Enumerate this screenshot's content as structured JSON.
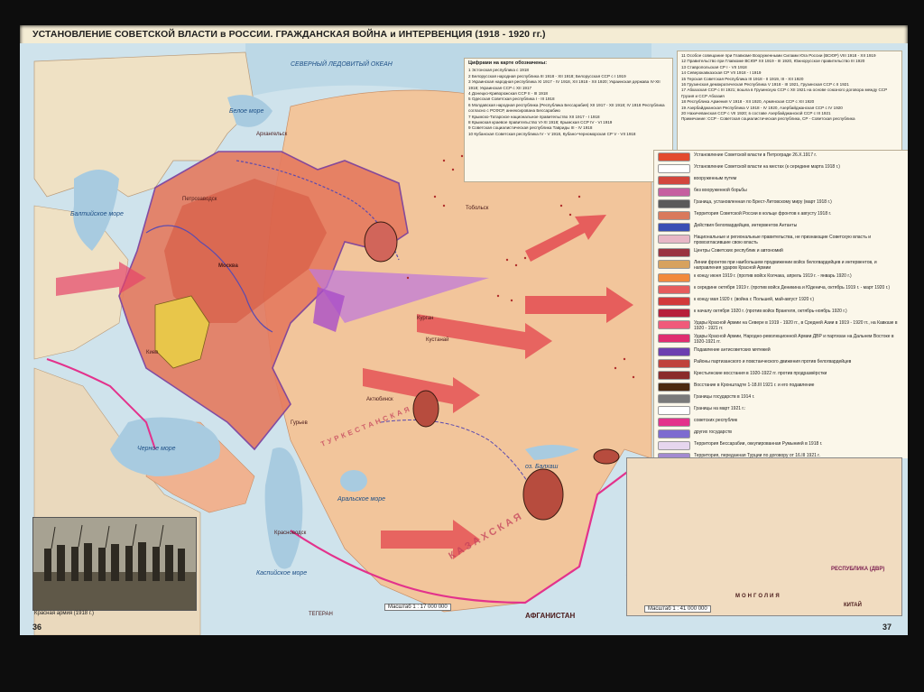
{
  "title": "УСТАНОВЛЕНИЕ СОВЕТСКОЙ ВЛАСТИ в РОССИИ. ГРАЖДАНСКАЯ ВОЙНА и ИНТЕРВЕНЦИЯ (1918 - 1920 гг.)",
  "page_left": "36",
  "page_right": "37",
  "scale_main": "Масштаб 1 : 17 000 000",
  "scale_inset": "Масштаб 1 : 41 000 000",
  "photo_caption": "Красная армия (1918 г.)",
  "numbers_legend": {
    "heading": "Цифрами на карте обозначены:",
    "items": [
      "1 Эстонская республика с 1918",
      "2 Белорусская народная республика III 1918 - XII 1918; Белорусская ССР с I 1919",
      "3 Украинская народная республика XI 1917 - IV 1918, XII 1918 - XII 1920; Украинская держава IV-XII 1918; Украинская ССР с XII 1917",
      "4 Донецко-Криворожская ССР II - III 1918",
      "5 Одесская Советская республика I - III 1918",
      "6 Молдавская народная республика (Республика Бессарабия) XII 1917 - XII 1918; IV 1918 Республика согласно с РСФСР, аннексирована Бессарабию",
      "7 Крымско-Татарское национальное правительство XII 1917 - I 1918",
      "8 Крымская краевое правительство VI-XI 1918; Крымская ССР IV - VI 1919",
      "9 Советская социалистическая республика Тавриды III - IV 1918",
      "10 Кубанская Советская республика IV - V 1918, Кубано-Черноморская СР V - VII 1918"
    ]
  },
  "numbers_legend_2": {
    "items": [
      "11 Особое совещание при Главкоме Вооруженными Силами Юга России (ВСЮР) VIII 1918 - XII 1919",
      "12 Правительство при Главкоме ВСЮР XII 1919 - III 1920, Южнорусское правительство III 1920",
      "13 Ставропольская СР I - VII 1918",
      "14 Северокавказская СР VII 1918 - I 1919",
      "15 Терская Советская Республика III 1918 - II 1919, III - XII 1920",
      "16 Грузинская демократическая Республика V 1918 - III 1921, Грузинская ССР с II 1921",
      "17 Абхазская ССР с III 1921; вошла в Грузинскую ССР с XII 1921 на основе союзного договора между ССР Грузия и ССР Абхазия",
      "18 Республика Армения V 1918 - XII 1920, Армянская ССР с XII 1920",
      "19 Азербайджанская Республика V 1918 - IV 1920, Азербайджанская ССР с IV 1920",
      "20 Нахичеванская ССР с VII 1920; в составе Азербайджанской ССР с III 1921",
      "Примечание: ССР - Советская социалистическая республика, СР - Советская республика"
    ]
  },
  "legend": {
    "items": [
      {
        "color": "#e34b2e",
        "text": "Установление Советской власти в Петрограде 26.X.1917 г."
      },
      {
        "color": "#ffffff",
        "text": "Установление Советской власти на местах (к середине марта 1918 г.)"
      },
      {
        "color": "#d2453c",
        "text": "вооруженным путем"
      },
      {
        "color": "#c65fa0",
        "text": "без вооруженной борьбы"
      },
      {
        "color": "#5a5a5a",
        "text": "Граница, установленная по Брест-Литовскому миру (март 1918 г.)"
      },
      {
        "color": "#d9795b",
        "text": "Территория Советской России в кольце фронтов к августу 1918 г."
      },
      {
        "color": "#3a4fb4",
        "text": "Действия белогвардейцев, интервентов Антанты"
      },
      {
        "color": "#e8b7c6",
        "text": "Национальные и региональные правительства, не признающие Советскую власть и провозгласившие свою власть"
      },
      {
        "color": "#9a3340",
        "text": "Центры Советских республик и автономий"
      },
      {
        "color": "#d7a25e",
        "text": "Линии фронтов при наибольшем продвижении войск белогвардейцев и интервентов, и направления ударов Красной Армии"
      },
      {
        "color": "#f28a3c",
        "text": "к концу июня 1919 г. (против войск Колчака, апрель 1919 г. - январь 1920 г.)"
      },
      {
        "color": "#e65c5c",
        "text": "к середине октября 1919 г. (против войск Деникина и Юденича, октябрь 1919 г. - март 1920 г.)"
      },
      {
        "color": "#d23a3a",
        "text": "к концу мая 1920 г. (война с Польшей, май-август 1920 г.)"
      },
      {
        "color": "#b71f3a",
        "text": "к началу октября 1920 г. (против войск Врангеля, октябрь-ноябрь 1920 г.)"
      },
      {
        "color": "#f05a7a",
        "text": "Удары Красной Армии на Севере в 1919 - 1920 гг., в Средней Азии в 1919 - 1920 гг., на Кавказе в 1920 - 1921 гг."
      },
      {
        "color": "#e02d70",
        "text": "Удары Красной Армии, Народно-революционной Армии ДВР и партизан на Дальнем Востоке в 1920-1921 гг."
      },
      {
        "color": "#6d3fb0",
        "text": "Подавление антисоветских мятежей"
      },
      {
        "color": "#c0433c",
        "text": "Районы партизанского и повстанческого движения против белогвардейцев"
      },
      {
        "color": "#8a2b2b",
        "text": "Крестьянские восстания в 1920-1922 гг. против продразвёрстки"
      },
      {
        "color": "#4c2a10",
        "text": "Восстание в Кронштадте 1-18.III 1921 г. и его подавление"
      },
      {
        "color": "#7a7a7a",
        "text": "Границы государств в 1914 г."
      },
      {
        "color": "#ffffff",
        "text": "Границы на март 1921 г.:"
      },
      {
        "color": "#e3328c",
        "text": "советских республик"
      },
      {
        "color": "#7d6bd0",
        "text": "других государств"
      },
      {
        "color": "#e6d6ee",
        "text": "Территория Бессарабии, оккупированная Румынией в 1918 г."
      },
      {
        "color": "#a38ad0",
        "text": "Территория, переданная Турции по договору от 16.III 1921 г."
      }
    ]
  },
  "map_labels": {
    "ocean": "СЕВЕРНЫЙ ЛЕДОВИТЫЙ ОКЕАН",
    "white_sea": "Белое море",
    "baltic": "Балтийское море",
    "black_sea": "Черное море",
    "caspian": "Каспийское море",
    "aral": "Аральское море",
    "balkhash": "оз. Балхаш",
    "kazakh": "КАЗАХСКАЯ",
    "turkestan": "ТУРКЕСТАНСКАЯ",
    "afghanistan": "АФГАНИСТАН",
    "tegeran": "ТЕГЕРАН",
    "tobolsk": "Тобольск",
    "arkhangelsk": "Архангельск",
    "kurgan": "Курган",
    "kustanai": "Кустанай",
    "aktyubinsk": "Актюбинск",
    "guryev": "Гурьев",
    "krasnovodsk": "Красноводск",
    "petrozavodsk": "Петрозаводск",
    "moscow": "Москва",
    "kiev": "Киев",
    "dvr": "РЕСПУБЛИКА (ДВР)",
    "mongolia": "МОНГОЛИЯ",
    "kitay": "КИТАЙ"
  }
}
